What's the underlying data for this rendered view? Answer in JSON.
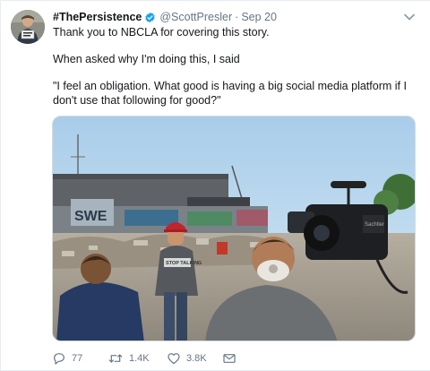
{
  "tweet": {
    "display_name": "#ThePersistence",
    "verified_icon": "verified-badge-icon",
    "handle": "@ScottPresler",
    "separator": "·",
    "time": "Sep 20",
    "lines": [
      "Thank you to NBCLA for covering this story.",
      "When asked why I'm doing this, I said",
      "\"I feel an obligation. What good is having a big social media platform if I",
      "don't use that following for good?\""
    ],
    "media": {
      "sign_text": "STOP TALKING",
      "camera_brand": "Sachtler"
    }
  },
  "actions": {
    "reply": {
      "icon": "reply-icon",
      "count": "77"
    },
    "retweet": {
      "icon": "retweet-icon",
      "count": "1.4K"
    },
    "like": {
      "icon": "heart-icon",
      "count": "3.8K"
    },
    "dm": {
      "icon": "envelope-icon"
    }
  },
  "colors": {
    "text": "#14171a",
    "secondary": "#657786",
    "verified": "#1da1f2",
    "border": "#e6ecf0"
  }
}
